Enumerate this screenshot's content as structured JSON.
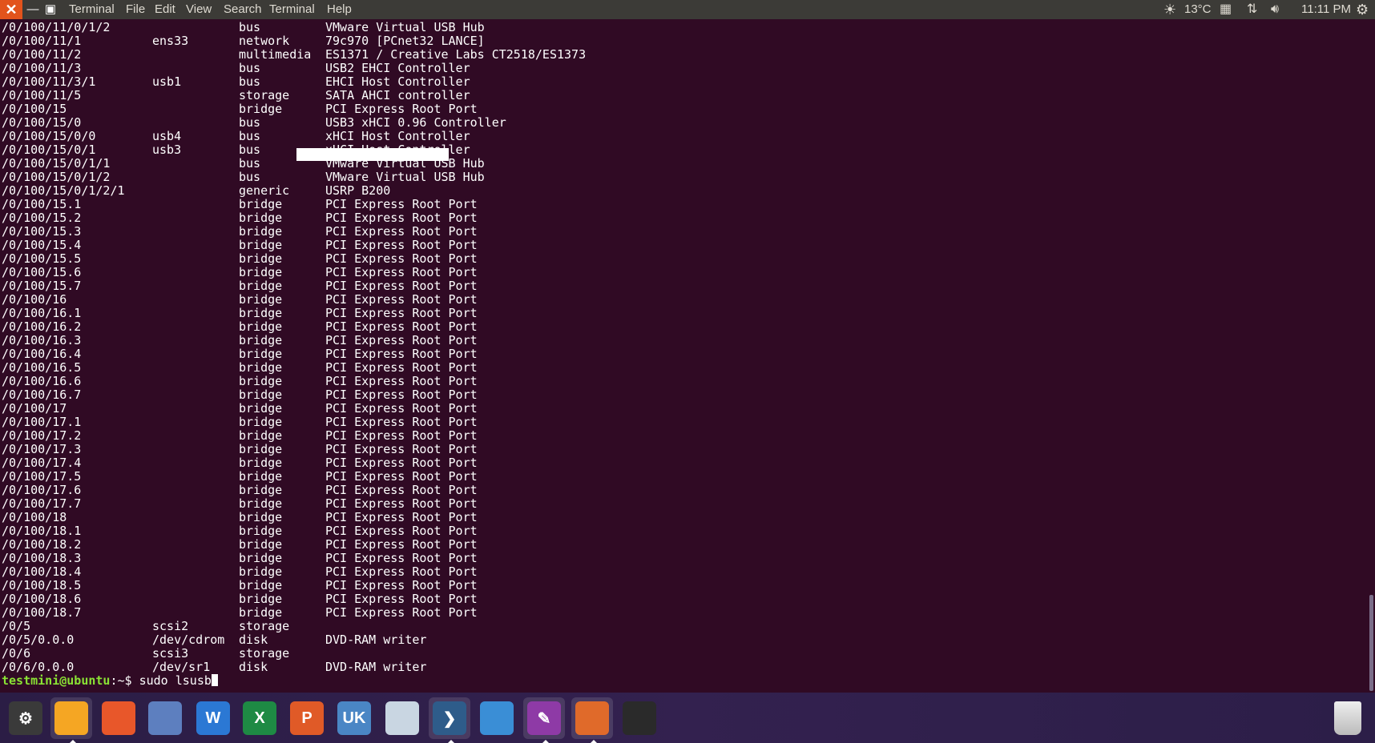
{
  "topbar": {
    "menu": [
      "Terminal",
      "File",
      "Edit",
      "View",
      "Search",
      "Terminal",
      "Help"
    ],
    "close_label": "✕",
    "minimize_label": "—",
    "maximize_label": "▣",
    "weather": "13°C",
    "time": "11:11 PM"
  },
  "terminal": {
    "rows": [
      [
        "/0/100/11/0/1/2",
        "",
        "bus",
        "VMware Virtual USB Hub"
      ],
      [
        "/0/100/11/1",
        "ens33",
        "network",
        "79c970 [PCnet32 LANCE]"
      ],
      [
        "/0/100/11/2",
        "",
        "multimedia",
        "ES1371 / Creative Labs CT2518/ES1373"
      ],
      [
        "/0/100/11/3",
        "",
        "bus",
        "USB2 EHCI Controller"
      ],
      [
        "/0/100/11/3/1",
        "usb1",
        "bus",
        "EHCI Host Controller"
      ],
      [
        "/0/100/11/5",
        "",
        "storage",
        "SATA AHCI controller"
      ],
      [
        "/0/100/15",
        "",
        "bridge",
        "PCI Express Root Port"
      ],
      [
        "/0/100/15/0",
        "",
        "bus",
        "USB3 xHCI 0.96 Controller"
      ],
      [
        "/0/100/15/0/0",
        "usb4",
        "bus",
        "xHCI Host Controller"
      ],
      [
        "/0/100/15/0/1",
        "usb3",
        "bus",
        "xHCI Host Controller"
      ],
      [
        "/0/100/15/0/1/1",
        "",
        "bus",
        "VMware Virtual USB Hub"
      ],
      [
        "/0/100/15/0/1/2",
        "",
        "bus",
        "VMware Virtual USB Hub"
      ],
      [
        "/0/100/15/0/1/2/1",
        "",
        "generic",
        "USRP B200"
      ],
      [
        "/0/100/15.1",
        "",
        "bridge",
        "PCI Express Root Port"
      ],
      [
        "/0/100/15.2",
        "",
        "bridge",
        "PCI Express Root Port"
      ],
      [
        "/0/100/15.3",
        "",
        "bridge",
        "PCI Express Root Port"
      ],
      [
        "/0/100/15.4",
        "",
        "bridge",
        "PCI Express Root Port"
      ],
      [
        "/0/100/15.5",
        "",
        "bridge",
        "PCI Express Root Port"
      ],
      [
        "/0/100/15.6",
        "",
        "bridge",
        "PCI Express Root Port"
      ],
      [
        "/0/100/15.7",
        "",
        "bridge",
        "PCI Express Root Port"
      ],
      [
        "/0/100/16",
        "",
        "bridge",
        "PCI Express Root Port"
      ],
      [
        "/0/100/16.1",
        "",
        "bridge",
        "PCI Express Root Port"
      ],
      [
        "/0/100/16.2",
        "",
        "bridge",
        "PCI Express Root Port"
      ],
      [
        "/0/100/16.3",
        "",
        "bridge",
        "PCI Express Root Port"
      ],
      [
        "/0/100/16.4",
        "",
        "bridge",
        "PCI Express Root Port"
      ],
      [
        "/0/100/16.5",
        "",
        "bridge",
        "PCI Express Root Port"
      ],
      [
        "/0/100/16.6",
        "",
        "bridge",
        "PCI Express Root Port"
      ],
      [
        "/0/100/16.7",
        "",
        "bridge",
        "PCI Express Root Port"
      ],
      [
        "/0/100/17",
        "",
        "bridge",
        "PCI Express Root Port"
      ],
      [
        "/0/100/17.1",
        "",
        "bridge",
        "PCI Express Root Port"
      ],
      [
        "/0/100/17.2",
        "",
        "bridge",
        "PCI Express Root Port"
      ],
      [
        "/0/100/17.3",
        "",
        "bridge",
        "PCI Express Root Port"
      ],
      [
        "/0/100/17.4",
        "",
        "bridge",
        "PCI Express Root Port"
      ],
      [
        "/0/100/17.5",
        "",
        "bridge",
        "PCI Express Root Port"
      ],
      [
        "/0/100/17.6",
        "",
        "bridge",
        "PCI Express Root Port"
      ],
      [
        "/0/100/17.7",
        "",
        "bridge",
        "PCI Express Root Port"
      ],
      [
        "/0/100/18",
        "",
        "bridge",
        "PCI Express Root Port"
      ],
      [
        "/0/100/18.1",
        "",
        "bridge",
        "PCI Express Root Port"
      ],
      [
        "/0/100/18.2",
        "",
        "bridge",
        "PCI Express Root Port"
      ],
      [
        "/0/100/18.3",
        "",
        "bridge",
        "PCI Express Root Port"
      ],
      [
        "/0/100/18.4",
        "",
        "bridge",
        "PCI Express Root Port"
      ],
      [
        "/0/100/18.5",
        "",
        "bridge",
        "PCI Express Root Port"
      ],
      [
        "/0/100/18.6",
        "",
        "bridge",
        "PCI Express Root Port"
      ],
      [
        "/0/100/18.7",
        "",
        "bridge",
        "PCI Express Root Port"
      ],
      [
        "/0/5",
        "scsi2",
        "storage",
        ""
      ],
      [
        "/0/5/0.0.0",
        "/dev/cdrom",
        "disk",
        "DVD-RAM writer"
      ],
      [
        "/0/6",
        "scsi3",
        "storage",
        ""
      ],
      [
        "/0/6/0.0.0",
        "/dev/sr1",
        "disk",
        "DVD-RAM writer"
      ]
    ],
    "prompt_user": "testmini@ubuntu",
    "prompt_path": ":~$",
    "command": " sudo lsusb"
  },
  "dock": {
    "apps": [
      {
        "name": "system-settings-icon",
        "label": "⚙",
        "color": "#3a3a3a"
      },
      {
        "name": "files-icon",
        "label": "",
        "color": "#f5a623"
      },
      {
        "name": "firefox-icon",
        "label": "",
        "color": "#e8572a"
      },
      {
        "name": "chromium-icon",
        "label": "",
        "color": "#5d7fbf"
      },
      {
        "name": "word-icon",
        "label": "W",
        "color": "#2b78d4"
      },
      {
        "name": "excel-icon",
        "label": "X",
        "color": "#1e8a44"
      },
      {
        "name": "powerpoint-icon",
        "label": "P",
        "color": "#e05a27"
      },
      {
        "name": "uk-bag-icon",
        "label": "UK",
        "color": "#4a86c5"
      },
      {
        "name": "ship-icon",
        "label": "",
        "color": "#c9d6e2"
      },
      {
        "name": "vscode-icon",
        "label": "❯",
        "color": "#2e5c8a"
      },
      {
        "name": "window-manager-icon",
        "label": "",
        "color": "#3a8ed6"
      },
      {
        "name": "editor-icon",
        "label": "✎",
        "color": "#8e3aa6"
      },
      {
        "name": "gnuradio-icon",
        "label": "",
        "color": "#e06a2a"
      },
      {
        "name": "save-disk-icon",
        "label": "",
        "color": "#2a2a2a"
      }
    ],
    "trash": "trash-icon"
  }
}
